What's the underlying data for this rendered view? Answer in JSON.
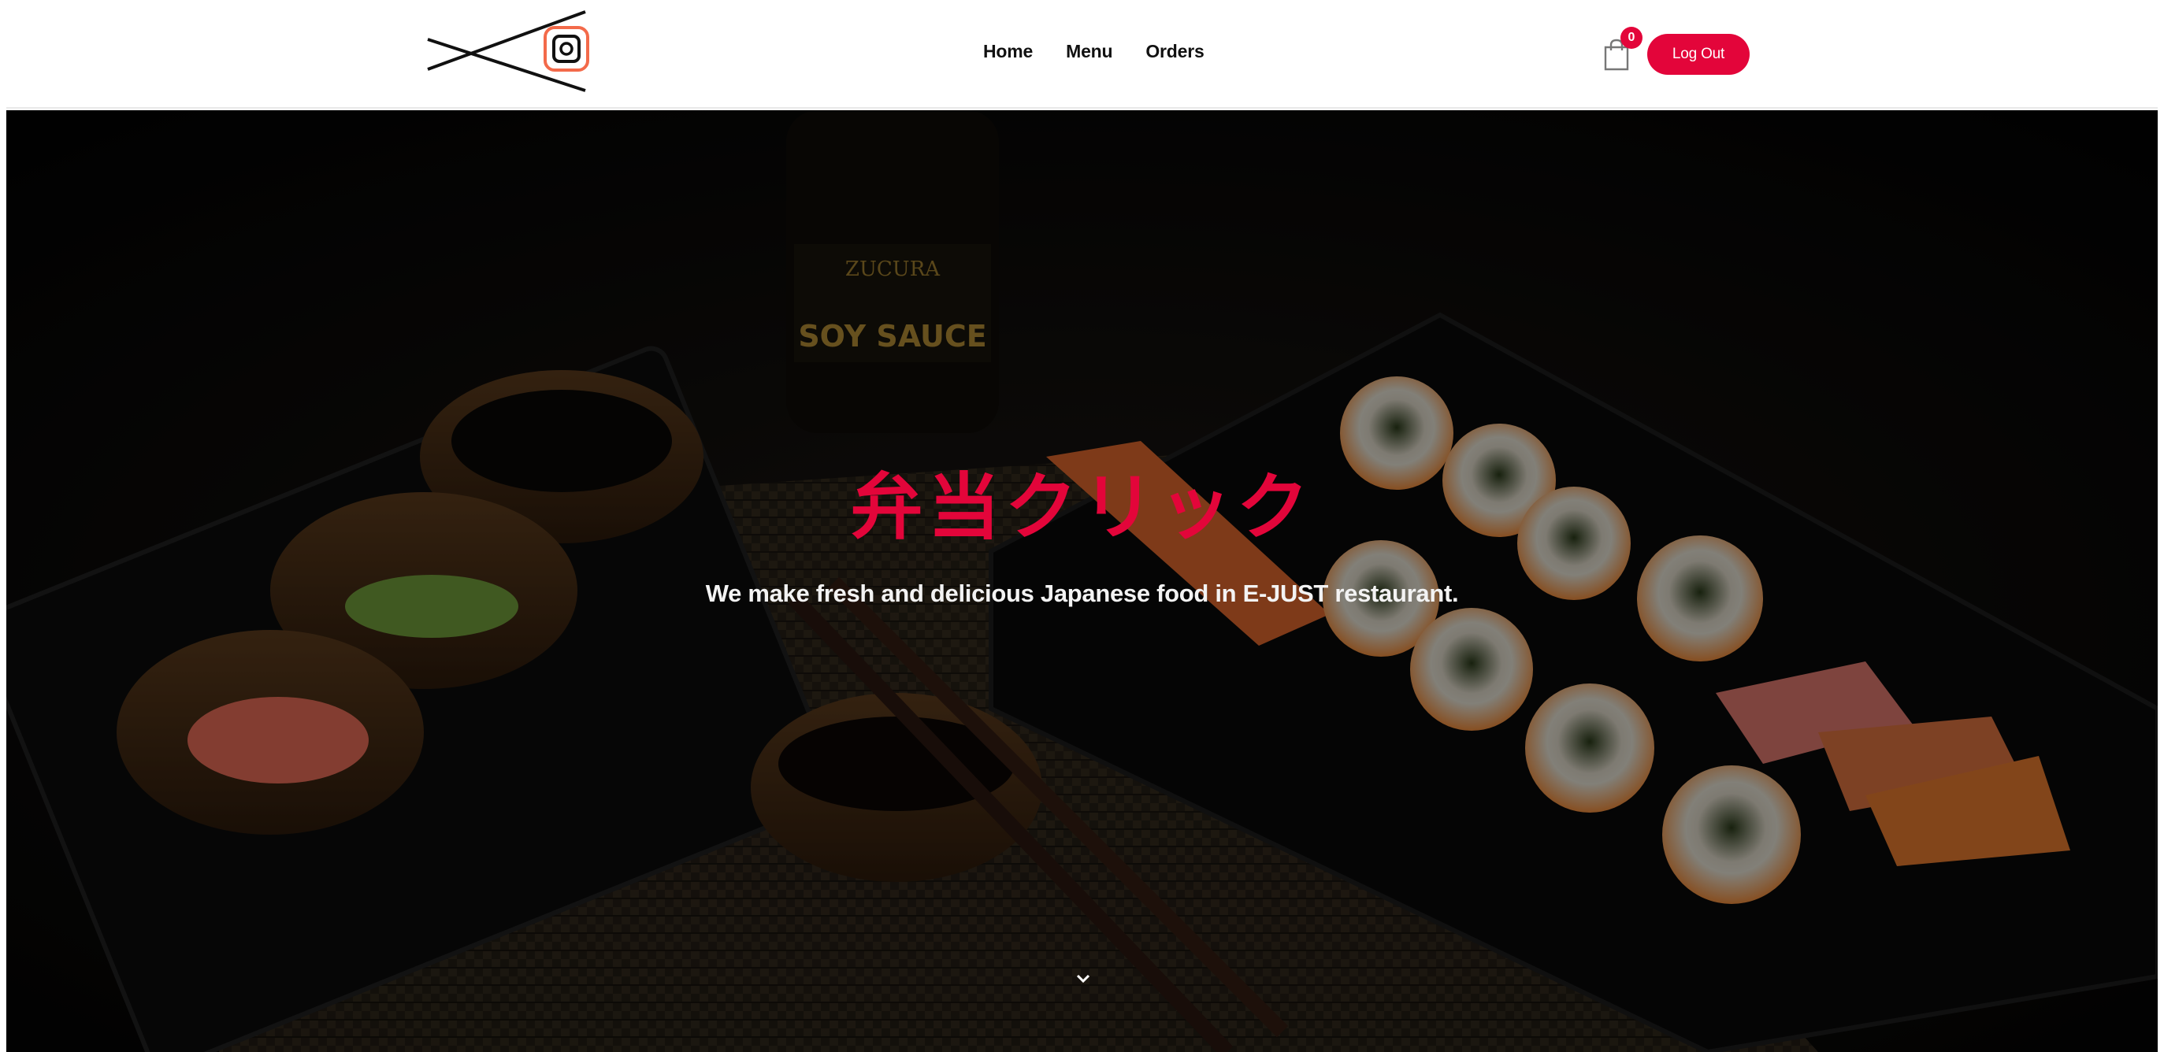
{
  "header": {
    "nav": [
      {
        "label": "Home"
      },
      {
        "label": "Menu"
      },
      {
        "label": "Orders"
      }
    ],
    "cart_count": "0",
    "logout_label": "Log Out",
    "icons": {
      "logo": "chopsticks-logo-icon",
      "cart": "shopping-bag-icon"
    }
  },
  "hero": {
    "title": "弁当クリック",
    "tagline": "We make fresh and delicious Japanese food in E-JUST restaurant.",
    "scroll_icon": "chevron-down-icon"
  },
  "colors": {
    "accent": "#e3053a",
    "hero_bg": "#060606",
    "header_bg": "#ffffff"
  }
}
